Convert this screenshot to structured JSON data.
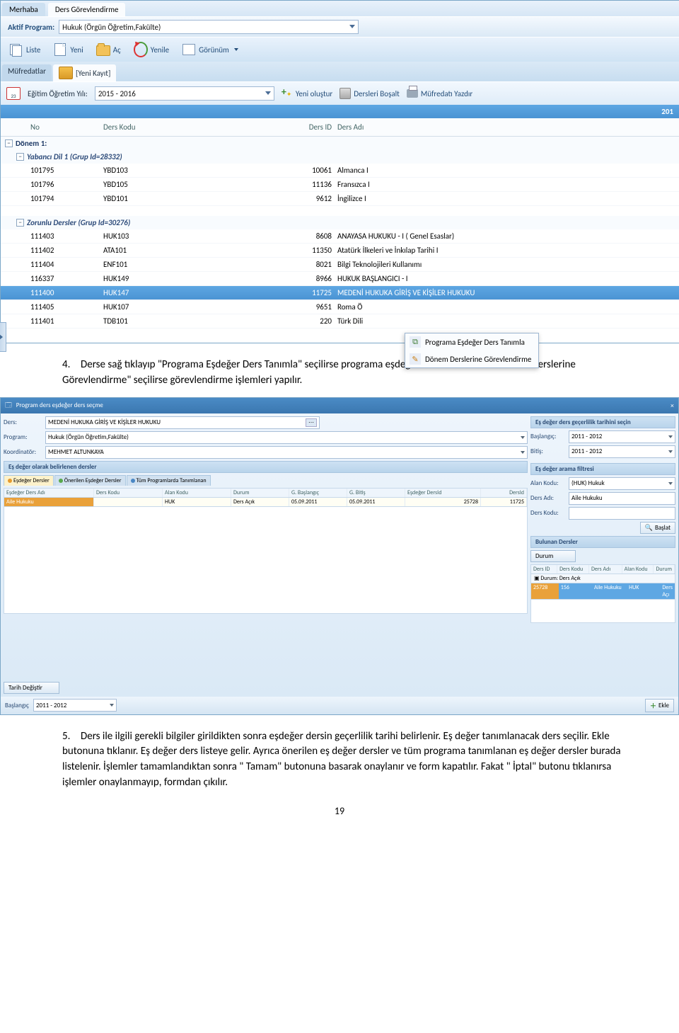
{
  "app1": {
    "tabs": [
      "Merhaba",
      "Ders Görevlendirme"
    ],
    "active_tab": 1,
    "active_program_label": "Aktif Program:",
    "active_program_value": "Hukuk  (Örgün Öğretim,Fakülte)",
    "toolbar": {
      "liste": "Liste",
      "yeni": "Yeni",
      "ac": "Aç",
      "yenile": "Yenile",
      "gorunum": "Görünüm"
    },
    "subtabs": {
      "mufredatlar": "Müfredatlar",
      "yeni_kayit": "[Yeni Kayıt]"
    },
    "filter": {
      "year_label": "Eğitim Öğretim Yılı:",
      "year_value": "2015 - 2016",
      "yeni_olustur": "Yeni oluştur",
      "dersleri_bosalt": "Dersleri Boşalt",
      "mufredati_yazdir": "Müfredatı Yazdır"
    },
    "year_banner": "201",
    "columns": {
      "no": "No",
      "kod": "Ders Kodu",
      "id": "Ders ID",
      "ad": "Ders Adı"
    },
    "groups": [
      {
        "title": "Dönem 1:",
        "sub": [
          {
            "title": "Yabancı Dil 1 (Grup Id=28332)",
            "rows": [
              {
                "no": "101795",
                "kod": "YBD103",
                "id": "10061",
                "ad": "Almanca I"
              },
              {
                "no": "101796",
                "kod": "YBD105",
                "id": "11136",
                "ad": "Fransızca I"
              },
              {
                "no": "101794",
                "kod": "YBD101",
                "id": "9612",
                "ad": "İngilizce I"
              }
            ]
          },
          {
            "title": "Zorunlu Dersler (Grup Id=30276)",
            "rows": [
              {
                "no": "111403",
                "kod": "HUK103",
                "id": "8608",
                "ad": "ANAYASA HUKUKU - I ( Genel Esaslar)"
              },
              {
                "no": "111402",
                "kod": "ATA101",
                "id": "11350",
                "ad": "Atatürk İlkeleri ve İnkılap Tarihi I"
              },
              {
                "no": "111404",
                "kod": "ENF101",
                "id": "8021",
                "ad": "Bilgi Teknolojileri Kullanımı"
              },
              {
                "no": "116337",
                "kod": "HUK149",
                "id": "8966",
                "ad": "HUKUK  BAŞLANGICI - I"
              },
              {
                "no": "111400",
                "kod": "HUK147",
                "id": "11725",
                "ad": "MEDENİ HUKUKA GİRİŞ VE KİŞİLER HUKUKU",
                "selected": true
              },
              {
                "no": "111405",
                "kod": "HUK107",
                "id": "9651",
                "ad": "Roma Ö"
              },
              {
                "no": "111401",
                "kod": "TDB101",
                "id": "220",
                "ad": "Türk Dili"
              }
            ]
          }
        ]
      }
    ],
    "ctx": {
      "m1": "Programa Eşdeğer Ders Tanımla",
      "m2": "Dönem Derslerine Görevlendirme"
    }
  },
  "para4": {
    "num": "4.",
    "text": "Derse sağ tıklayıp \"Programa Eşdeğer Ders Tanımla\" seçilirse programa eşdeğer ders tanımlanır. \" Dönem Derslerine Görevlendirme\" seçilirse görevlendirme işlemleri yapılır."
  },
  "app2": {
    "title": "Program ders eşdeğer ders seçme",
    "left": {
      "ders_label": "Ders:",
      "ders_val": "MEDENİ HUKUKA GİRİŞ VE KİŞİLER HUKUKU",
      "program_label": "Program:",
      "program_val": "Hukuk  (Örgün Öğretim,Fakülte)",
      "koord_label": "Koordinatör:",
      "koord_val": "MEHMET ALTUNKAYA",
      "section": "Eş değer olarak belirlenen dersler",
      "tabs": [
        "Eşdeğer Dersler",
        "Önerilen Eşdeğer Dersler",
        "Tüm Programlarda Tanımlanan"
      ],
      "cols": {
        "a": "Eşdeğer Ders Adı",
        "b": "Ders Kodu",
        "c": "Alan Kodu",
        "d": "Durum",
        "e": "G. Başlangıç",
        "f": "G. Bitiş",
        "g": "Eşdeğer DersId",
        "h": "DersId"
      },
      "row": {
        "a": "Aile Hukuku",
        "b": "",
        "c": "HUK",
        "d": "Ders Açık",
        "e": "05.09.2011",
        "f": "05.09.2011",
        "g": "25728",
        "h": "11725"
      },
      "tarih_degistir": "Tarih Değiştir",
      "baslangic_label": "Başlangıç",
      "baslangic_val": "2011 - 2012"
    },
    "right": {
      "sec": "Eş değer ders geçerlilik tarihini seçin",
      "bas_l": "Başlangıç:",
      "bas_v": "2011 - 2012",
      "bit_l": "Bitiş:",
      "bit_v": "2011 - 2012",
      "filtr": "Eş değer arama filtresi",
      "alan_l": "Alan Kodu:",
      "alan_v": "(HUK) Hukuk",
      "dad_l": "Ders Adı:",
      "dad_v": "Aile Hukuku",
      "dk_l": "Ders Kodu:",
      "dk_v": "",
      "baslat": "Başlat",
      "bul": "Bulunan Dersler",
      "durum": "Durum",
      "cols": {
        "a": "Ders ID",
        "b": "Ders Kodu",
        "c": "Ders Adı",
        "d": "Alan Kodu",
        "e": "Durum"
      },
      "grp": "Durum: Ders Açık",
      "row": {
        "a": "25728",
        "b": "156",
        "c": "Aile Hukuku",
        "d": "HUK",
        "e": "Ders Açı"
      },
      "ekle": "Ekle"
    }
  },
  "para5": {
    "num": "5.",
    "text": "Ders ile ilgili gerekli bilgiler girildikten sonra eşdeğer dersin geçerlilik tarihi belirlenir. Eş değer tanımlanacak ders seçilir. Ekle butonuna tıklanır. Eş değer ders listeye gelir.  Ayrıca önerilen eş değer dersler ve tüm programa tanımlanan eş değer dersler burada listelenir. İşlemler tamamlandıktan sonra \" Tamam\" butonuna basarak onaylanır ve form kapatılır. Fakat \" İptal\" butonu tıklanırsa işlemler onaylanmayıp, formdan çıkılır."
  },
  "page": "19"
}
